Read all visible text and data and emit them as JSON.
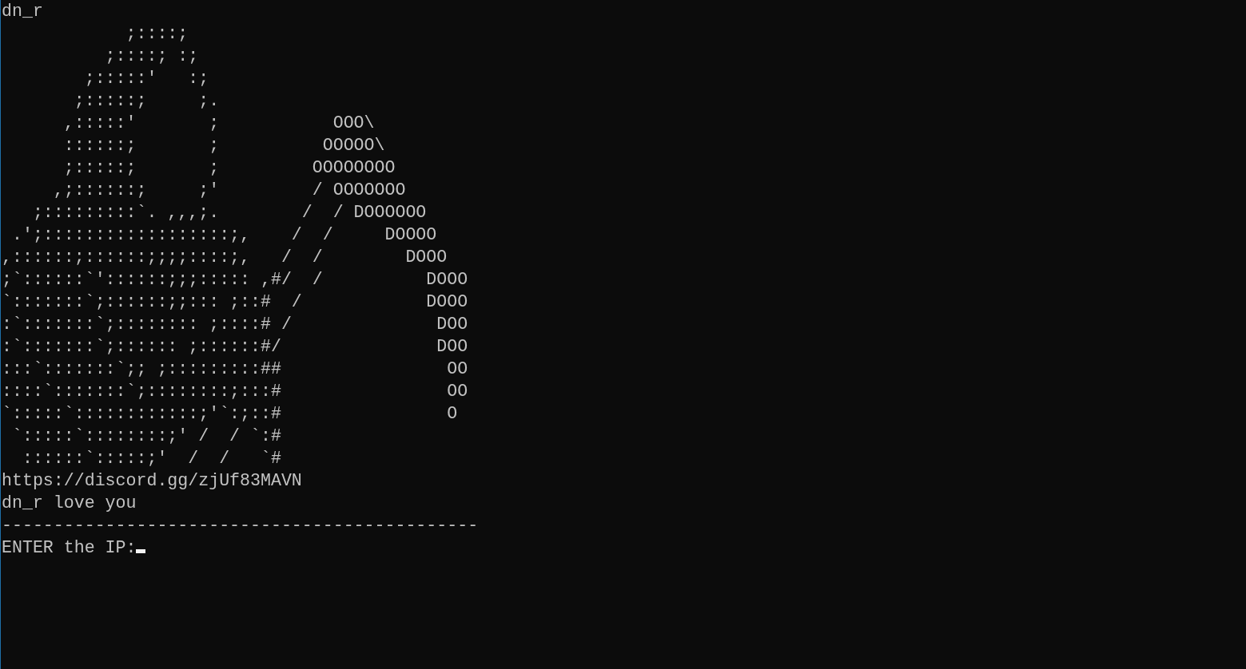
{
  "terminal": {
    "lines": [
      "dn_r",
      "            ;::::;",
      "          ;::::; :;",
      "        ;:::::'   :;",
      "       ;:::::;     ;.",
      "      ,:::::'       ;           OOO\\",
      "      ::::::;       ;          OOOOO\\",
      "      ;:::::;       ;         OOOOOOOO",
      "     ,;::::::;     ;'         / OOOOOOO",
      "   ;:::::::::`. ,,,;.        /  / DOOOOOO",
      " .';::::::::::::::::::;,    /  /     DOOOO",
      ",::::::;::::::;;;;::::;,   /  /        DOOO",
      ";`::::::`'::::::;;;::::: ,#/  /          DOOO",
      "`:::::::`;::::::;;::: ;::#  /            DOOO",
      ":`:::::::`;:::::::: ;::::# /              DOO",
      ":`:::::::`;:::::: ;::::::#/               DOO",
      ":::`:::::::`;; ;:::::::::##                OO",
      "::::`:::::::`;::::::::;:::#                OO",
      "`:::::`::::::::::::;'`:;::#                O",
      " `:::::`::::::::;' /  / `:#",
      "  ::::::`:::::;'  /  /   `#",
      "https://discord.gg/zjUf83MAVN",
      "dn_r love you",
      "----------------------------------------------"
    ],
    "prompt": {
      "label": "ENTER the IP:"
    }
  }
}
